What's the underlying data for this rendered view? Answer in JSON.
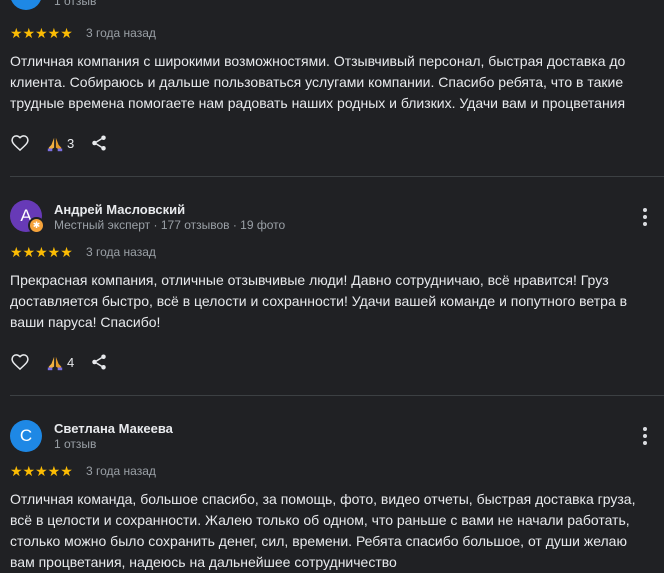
{
  "reviews": [
    {
      "author": "",
      "meta": "1 отзыв",
      "rating_stars": "★★★★★",
      "rating": 5,
      "date": "3 года назад",
      "text": "Отличная компания с широкими возможностями. Отзывчивый персонал, быстрая доставка до клиента. Собираюсь и дальше пользоваться услугами компании. Спасибо ребята, что в такие трудные времена помогаете нам радовать наших родных и близких. Удачи вам и процветания",
      "reactions": "3"
    },
    {
      "author": "Андрей Масловский",
      "avatar_letter": "А",
      "avatar_color": "#673ab7",
      "meta": "Местный эксперт · 177 отзывов · 19 фото",
      "rating_stars": "★★★★★",
      "rating": 5,
      "date": "3 года назад",
      "text": "Прекрасная компания, отличные отзывчивые люди! Давно сотрудничаю, всё нравится! Груз доставляется быстро, всё в целости и сохранности! Удачи вашей команде и попутного ветра в ваши паруса! Спасибо!",
      "reactions": "4"
    },
    {
      "author": "Светлана Макеева",
      "avatar_letter": "С",
      "avatar_color": "#1e88e5",
      "meta": "1 отзыв",
      "rating_stars": "★★★★★",
      "rating": 5,
      "date": "3 года назад",
      "text": "Отличная команда, большое спасибо, за помощь, фото, видео отчеты, быстрая доставка груза, всё в целости и сохранности. Жалею только об одном, что раньше с вами не начали работать, столько можно было сохранить денег, сил, времени. Ребята спасибо большое, от души желаю вам процветания, надеюсь на дальнейшее сотрудничество"
    }
  ],
  "colors": {
    "background": "#202124",
    "star": "#fbbc04",
    "badge": "#f6a33b"
  },
  "icons": {
    "like": "heart-icon",
    "thanks": "praying-hands-icon",
    "share": "share-icon",
    "more": "more-vertical-icon",
    "expert_badge": "local-guide-badge-icon"
  }
}
